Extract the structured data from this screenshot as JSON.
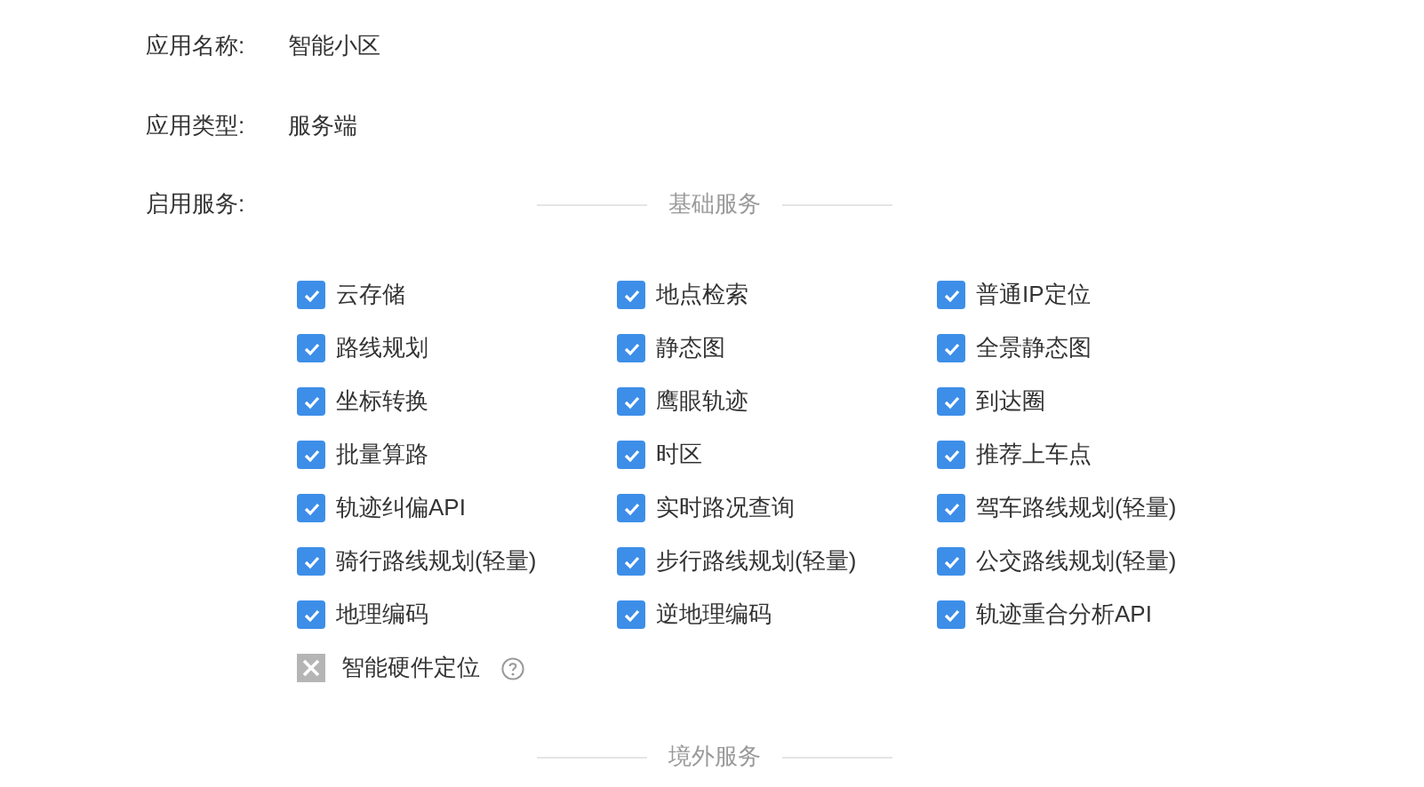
{
  "fields": [
    {
      "label": "应用名称:",
      "value": "智能小区"
    },
    {
      "label": "应用类型:",
      "value": "服务端"
    }
  ],
  "services_label": "启用服务:",
  "sections": [
    {
      "title": "基础服务",
      "services": [
        {
          "name": "云存储",
          "checked": true,
          "disabled": false,
          "help": false
        },
        {
          "name": "地点检索",
          "checked": true,
          "disabled": false,
          "help": false
        },
        {
          "name": "普通IP定位",
          "checked": true,
          "disabled": false,
          "help": false
        },
        {
          "name": "路线规划",
          "checked": true,
          "disabled": false,
          "help": false
        },
        {
          "name": "静态图",
          "checked": true,
          "disabled": false,
          "help": false
        },
        {
          "name": "全景静态图",
          "checked": true,
          "disabled": false,
          "help": false
        },
        {
          "name": "坐标转换",
          "checked": true,
          "disabled": false,
          "help": false
        },
        {
          "name": "鹰眼轨迹",
          "checked": true,
          "disabled": false,
          "help": false
        },
        {
          "name": "到达圈",
          "checked": true,
          "disabled": false,
          "help": false
        },
        {
          "name": "批量算路",
          "checked": true,
          "disabled": false,
          "help": false
        },
        {
          "name": "时区",
          "checked": true,
          "disabled": false,
          "help": false
        },
        {
          "name": "推荐上车点",
          "checked": true,
          "disabled": false,
          "help": false
        },
        {
          "name": "轨迹纠偏API",
          "checked": true,
          "disabled": false,
          "help": false
        },
        {
          "name": "实时路况查询",
          "checked": true,
          "disabled": false,
          "help": false
        },
        {
          "name": "驾车路线规划(轻量)",
          "checked": true,
          "disabled": false,
          "help": false
        },
        {
          "name": "骑行路线规划(轻量)",
          "checked": true,
          "disabled": false,
          "help": false
        },
        {
          "name": "步行路线规划(轻量)",
          "checked": true,
          "disabled": false,
          "help": false
        },
        {
          "name": "公交路线规划(轻量)",
          "checked": true,
          "disabled": false,
          "help": false
        },
        {
          "name": "地理编码",
          "checked": true,
          "disabled": false,
          "help": false
        },
        {
          "name": "逆地理编码",
          "checked": true,
          "disabled": false,
          "help": false
        },
        {
          "name": "轨迹重合分析API",
          "checked": true,
          "disabled": false,
          "help": false
        },
        {
          "name": "智能硬件定位",
          "checked": false,
          "disabled": true,
          "help": true
        }
      ]
    },
    {
      "title": "境外服务"
    }
  ]
}
